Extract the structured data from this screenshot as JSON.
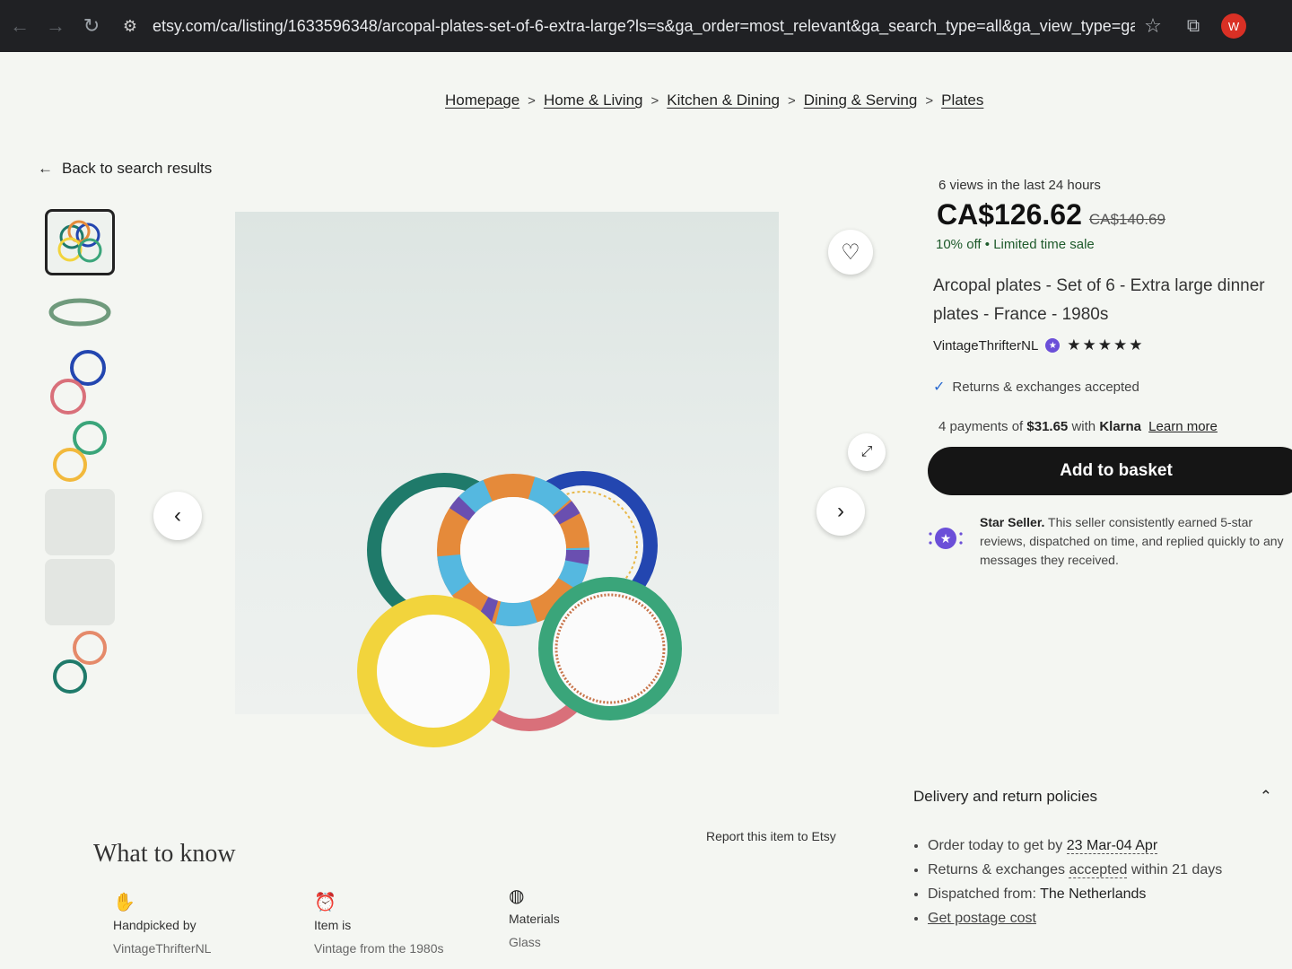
{
  "browser": {
    "url": "etsy.com/ca/listing/1633596348/arcopal-plates-set-of-6-extra-large?ls=s&ga_order=most_relevant&ga_search_type=all&ga_view_type=gallery...",
    "profile_letter": "W"
  },
  "breadcrumb": [
    "Homepage",
    "Home & Living",
    "Kitchen & Dining",
    "Dining & Serving",
    "Plates"
  ],
  "back_link": "Back to search results",
  "listing": {
    "views": "6 views in the last 24 hours",
    "price": "CA$126.62",
    "old_price": "CA$140.69",
    "discount": "10% off",
    "sale_note": "Limited time sale",
    "title": "Arcopal plates - Set of 6 - Extra large dinner plates - France - 1980s",
    "seller": "VintageThrifterNL",
    "rating_stars": "★★★★★",
    "returns": "Returns & exchanges accepted",
    "klarna_prefix": "4 payments of",
    "klarna_amount": "$31.65",
    "klarna_with": "with",
    "klarna_brand": "Klarna",
    "klarna_link": "Learn more",
    "add_to_basket": "Add to basket",
    "star_seller_title": "Star Seller.",
    "star_seller_text": "This seller consistently earned 5-star reviews, dispatched on time, and replied quickly to any messages they received."
  },
  "delivery": {
    "title": "Delivery and return policies",
    "order_prefix": "Order today to get by",
    "order_dates": "23 Mar-04 Apr",
    "returns_prefix": "Returns & exchanges",
    "returns_accepted": "accepted",
    "returns_suffix": "within 21 days",
    "dispatched_prefix": "Dispatched from:",
    "dispatched_from": "The Netherlands",
    "postage_link": "Get postage cost"
  },
  "report": "Report this item to Etsy",
  "what_to_know": {
    "title": "What to know",
    "items": [
      {
        "label": "Handpicked by",
        "value": "VintageThrifterNL",
        "icon": "hand-icon"
      },
      {
        "label": "Item is",
        "value": "Vintage from the 1980s",
        "icon": "alarm-clock-icon"
      },
      {
        "label": "Materials",
        "value": "Glass",
        "icon": "yarn-ball-icon"
      }
    ]
  },
  "colors": {
    "plate_yellow": "#f2d43c",
    "plate_green": "#3aa57a",
    "plate_teal": "#1f7a6a",
    "plate_blue": "#2346b0",
    "plate_pink": "#d9707a",
    "accent_purple": "#6b4fd8"
  }
}
